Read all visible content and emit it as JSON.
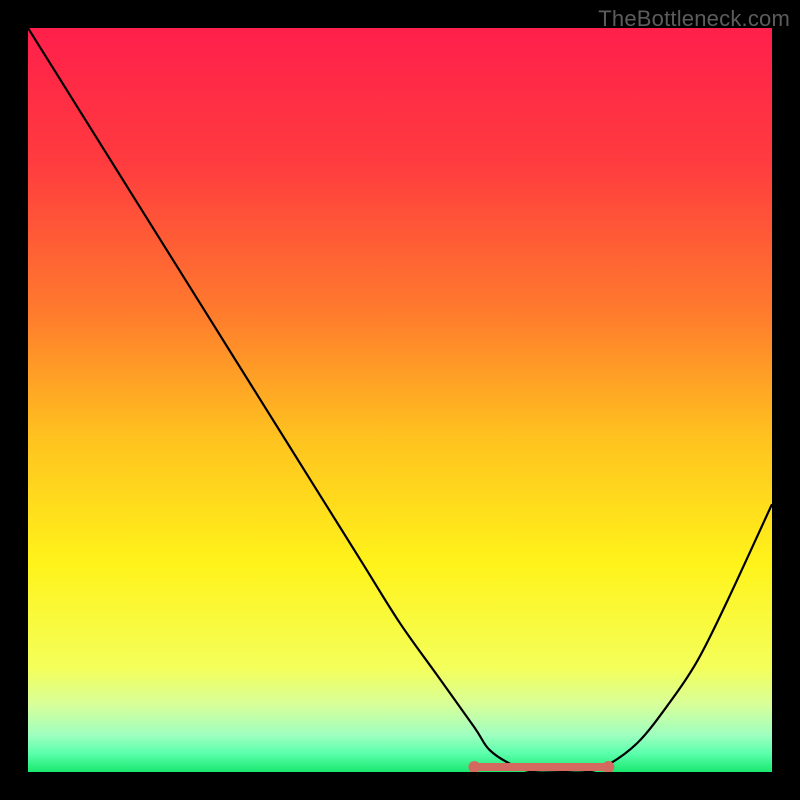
{
  "watermark": "TheBottleneck.com",
  "chart_data": {
    "type": "line",
    "title": "",
    "xlabel": "",
    "ylabel": "",
    "xlim": [
      0,
      100
    ],
    "ylim": [
      0,
      100
    ],
    "x": [
      0,
      5,
      10,
      15,
      20,
      25,
      30,
      35,
      40,
      45,
      50,
      55,
      60,
      62,
      65,
      68,
      72,
      75,
      78,
      82,
      86,
      90,
      94,
      100
    ],
    "values": [
      100,
      92,
      84,
      76,
      68,
      60,
      52,
      44,
      36,
      28,
      20,
      13,
      6,
      3,
      1,
      0,
      0,
      0,
      1,
      4,
      9,
      15,
      23,
      36
    ],
    "flat_region": {
      "x_start": 60,
      "x_end": 78,
      "y": 0
    },
    "gradient_stops": [
      {
        "offset": 0.0,
        "color": "#ff1f4b"
      },
      {
        "offset": 0.18,
        "color": "#ff3b3f"
      },
      {
        "offset": 0.38,
        "color": "#ff7a2d"
      },
      {
        "offset": 0.55,
        "color": "#ffc21f"
      },
      {
        "offset": 0.72,
        "color": "#fff31a"
      },
      {
        "offset": 0.86,
        "color": "#f4ff5a"
      },
      {
        "offset": 0.91,
        "color": "#d7ff9a"
      },
      {
        "offset": 0.95,
        "color": "#9fffc0"
      },
      {
        "offset": 0.975,
        "color": "#5bffac"
      },
      {
        "offset": 1.0,
        "color": "#19e86f"
      }
    ],
    "curve_color": "#000000",
    "flat_marker_color": "#d46a5f"
  }
}
